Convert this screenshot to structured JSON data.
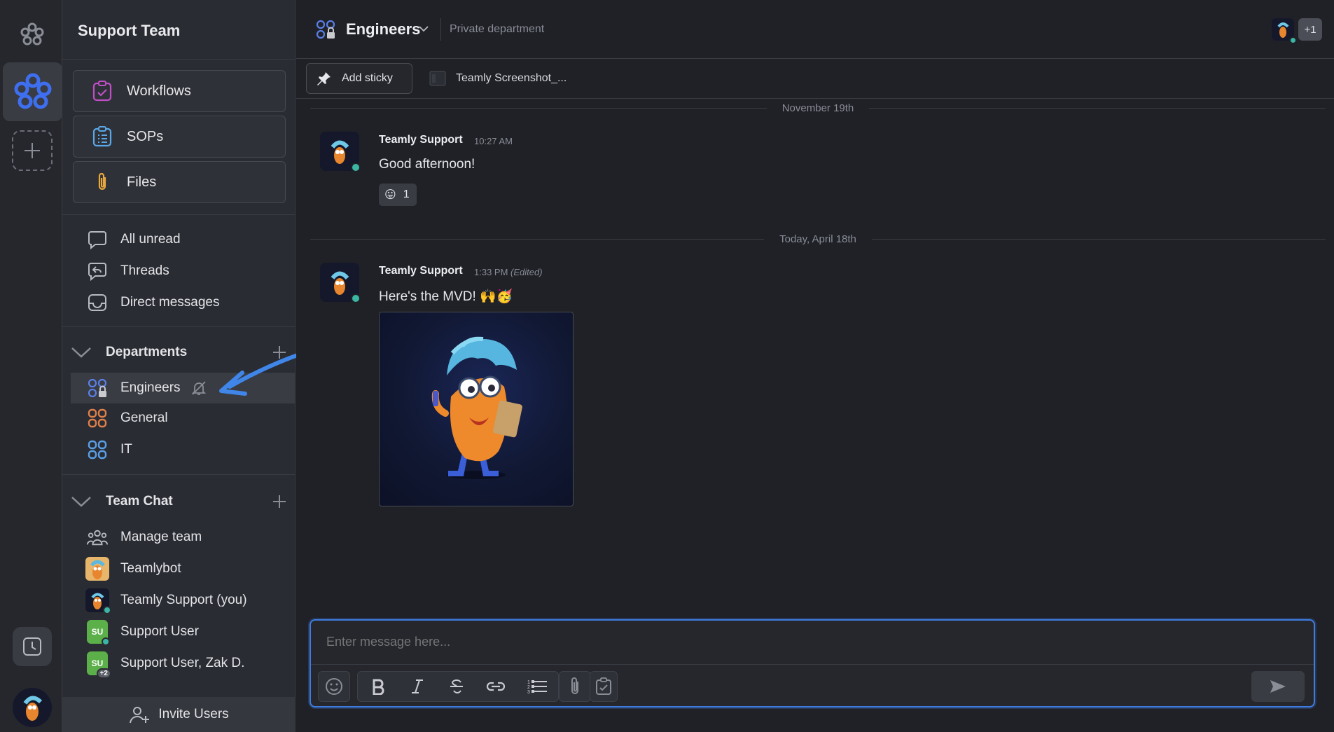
{
  "colors": {
    "accent": "#3e7ce0",
    "online": "#3cb6a4",
    "workflows": "#c04fc7",
    "sops": "#5aa8e8",
    "files": "#e8a83c",
    "general": "#e0804a",
    "it": "#5aa0e8",
    "user_badge": "#5cb04a"
  },
  "sidebar": {
    "team_title": "Support Team",
    "tools": [
      {
        "label": "Workflows",
        "icon": "clipboard-check-icon"
      },
      {
        "label": "SOPs",
        "icon": "clipboard-list-icon"
      },
      {
        "label": "Files",
        "icon": "paperclip-icon"
      }
    ],
    "nav": [
      {
        "label": "All unread",
        "icon": "chat-bubble-icon"
      },
      {
        "label": "Threads",
        "icon": "thread-icon"
      },
      {
        "label": "Direct messages",
        "icon": "inbox-icon"
      }
    ],
    "departments": {
      "label": "Departments",
      "items": [
        {
          "label": "Engineers",
          "icon": "department-locked-icon",
          "muted": true
        },
        {
          "label": "General",
          "icon": "department-icon"
        },
        {
          "label": "IT",
          "icon": "department-icon"
        }
      ]
    },
    "team_chat": {
      "label": "Team Chat",
      "items": [
        {
          "label": "Manage team",
          "icon": "team-icon"
        },
        {
          "label": "Teamlybot",
          "icon": "bot-avatar"
        },
        {
          "label": "Teamly Support (you)",
          "icon": "mascot-avatar"
        },
        {
          "label": "Support User",
          "initials": "SU"
        },
        {
          "label": "Support User, Zak D.",
          "initials": "SU",
          "extra": "+2"
        }
      ]
    },
    "invite_label": "Invite Users"
  },
  "header": {
    "channel_name": "Engineers",
    "channel_desc": "Private department",
    "extra_members": "+1"
  },
  "toolbar": {
    "add_sticky": "Add sticky",
    "file_tab": "Teamly Screenshot_..."
  },
  "messages": {
    "date1": "November 19th",
    "date2": "Today, April 18th",
    "m1": {
      "author": "Teamly Support",
      "time": "10:27 AM",
      "text": "Good afternoon!",
      "reaction_emoji": "😛",
      "reaction_count": "1"
    },
    "m2": {
      "author": "Teamly Support",
      "time": "1:33 PM",
      "edited": "(Edited)",
      "text": "Here's the MVD! 🙌🥳"
    }
  },
  "composer": {
    "placeholder": "Enter message here..."
  }
}
